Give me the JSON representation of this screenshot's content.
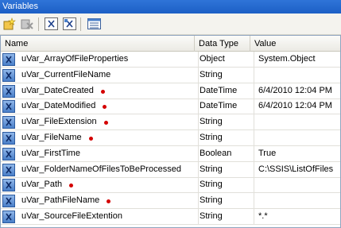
{
  "window": {
    "title": "Variables"
  },
  "toolbar": {
    "buttons": [
      {
        "icon": "add-variable-icon"
      },
      {
        "icon": "delete-variable-icon"
      },
      {
        "icon": "show-system-variables-icon"
      },
      {
        "icon": "show-all-variables-icon"
      },
      {
        "icon": "choose-columns-icon"
      }
    ]
  },
  "columns": {
    "name": "Name",
    "type": "Data Type",
    "value": "Value"
  },
  "marker_color": "#d40000",
  "rows": [
    {
      "name": "uVar_ArrayOfFileProperties",
      "type": "Object",
      "value": "System.Object",
      "marked": false
    },
    {
      "name": "uVar_CurrentFileName",
      "type": "String",
      "value": "",
      "marked": false
    },
    {
      "name": "uVar_DateCreated",
      "type": "DateTime",
      "value": "6/4/2010 12:04 PM",
      "marked": true
    },
    {
      "name": "uVar_DateModified",
      "type": "DateTime",
      "value": "6/4/2010 12:04 PM",
      "marked": true
    },
    {
      "name": "uVar_FileExtension",
      "type": "String",
      "value": "",
      "marked": true
    },
    {
      "name": "uVar_FileName",
      "type": "String",
      "value": "",
      "marked": true
    },
    {
      "name": "uVar_FirstTime",
      "type": "Boolean",
      "value": "True",
      "marked": false
    },
    {
      "name": "uVar_FolderNameOfFilesToBeProcessed",
      "type": "String",
      "value": "C:\\SSIS\\ListOfFiles",
      "marked": false
    },
    {
      "name": "uVar_Path",
      "type": "String",
      "value": "",
      "marked": true
    },
    {
      "name": "uVar_PathFileName",
      "type": "String",
      "value": "",
      "marked": true
    },
    {
      "name": "uVar_SourceFileExtention",
      "type": "String",
      "value": "*.*",
      "marked": false
    }
  ]
}
